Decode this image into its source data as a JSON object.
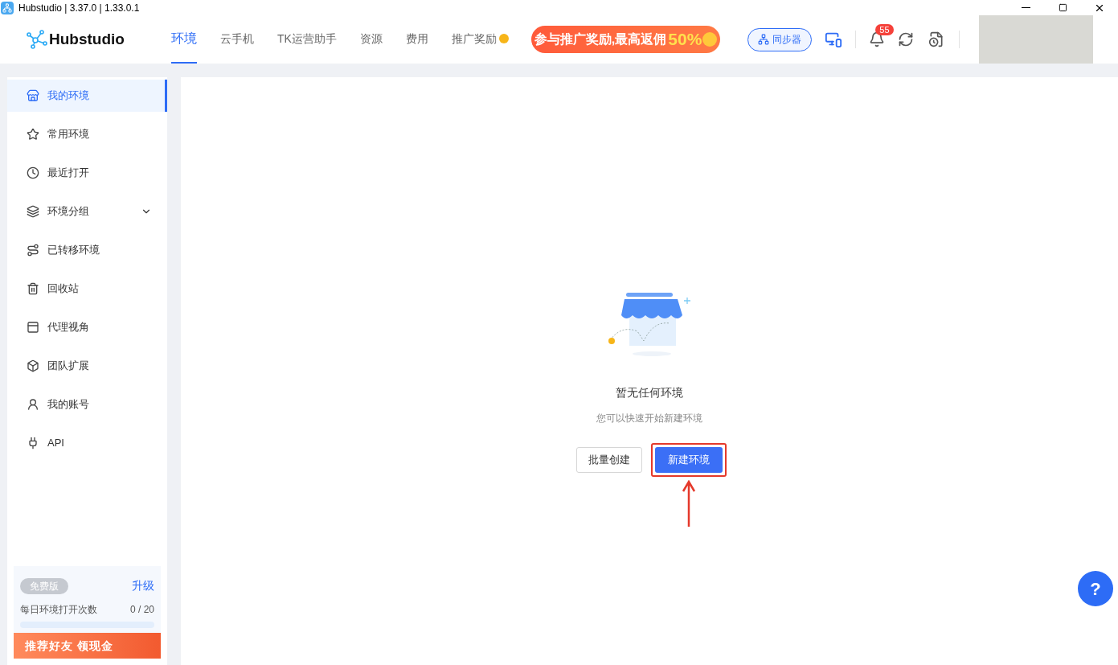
{
  "window": {
    "title": "Hubstudio | 3.37.0 | 1.33.0.1"
  },
  "logo": {
    "text": "Hubstudio"
  },
  "nav": [
    {
      "label": "环境",
      "selected": true,
      "coin": false
    },
    {
      "label": "云手机",
      "selected": false,
      "coin": false
    },
    {
      "label": "TK运营助手",
      "selected": false,
      "coin": false
    },
    {
      "label": "资源",
      "selected": false,
      "coin": false
    },
    {
      "label": "费用",
      "selected": false,
      "coin": false
    },
    {
      "label": "推广奖励",
      "selected": false,
      "coin": true
    }
  ],
  "promo_banner": {
    "text": "参与推广奖励,最高返佣",
    "highlight": "50%"
  },
  "sync_button": {
    "label": "同步器"
  },
  "notifications": {
    "badge": "55"
  },
  "sidebar": {
    "items": [
      {
        "label": "我的环境",
        "kind": "store",
        "selected": true,
        "expandable": false
      },
      {
        "label": "常用环境",
        "kind": "star",
        "selected": false,
        "expandable": false
      },
      {
        "label": "最近打开",
        "kind": "clock",
        "selected": false,
        "expandable": false
      },
      {
        "label": "环境分组",
        "kind": "layers",
        "selected": false,
        "expandable": true
      },
      {
        "label": "已转移环境",
        "kind": "route",
        "selected": false,
        "expandable": false
      },
      {
        "label": "回收站",
        "kind": "trash",
        "selected": false,
        "expandable": false
      },
      {
        "label": "代理视角",
        "kind": "panel",
        "selected": false,
        "expandable": false
      },
      {
        "label": "团队扩展",
        "kind": "box",
        "selected": false,
        "expandable": false
      },
      {
        "label": "我的账号",
        "kind": "user",
        "selected": false,
        "expandable": false
      },
      {
        "label": "API",
        "kind": "plug",
        "selected": false,
        "expandable": false
      }
    ],
    "plan": {
      "badge": "免费版",
      "upgrade": "升级",
      "quota_label": "每日环境打开次数",
      "quota_value": "0 / 20",
      "level": 0
    },
    "referral_banner": {
      "text": "推荐好友 领现金"
    }
  },
  "empty_state": {
    "title": "暂无任何环境",
    "subtitle": "您可以快速开始新建环境",
    "buttons": [
      {
        "label": "批量创建",
        "kind": "secondary"
      },
      {
        "label": "新建环境",
        "kind": "primary",
        "highlighted": true
      }
    ]
  },
  "help_button": {
    "label": "?"
  }
}
